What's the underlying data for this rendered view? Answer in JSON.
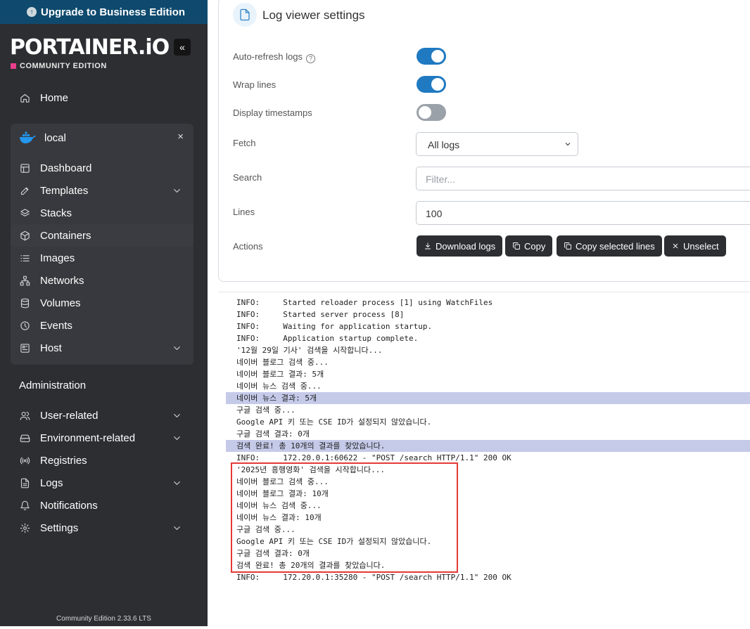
{
  "sidebar": {
    "upgrade_label": "Upgrade to Business Edition",
    "logo": "PORTAINER.iO",
    "edition": "COMMUNITY EDITION",
    "collapse_glyph": "«",
    "home": "Home",
    "environment": {
      "name": "local",
      "close": "×"
    },
    "env_items": [
      {
        "label": "Dashboard"
      },
      {
        "label": "Templates"
      },
      {
        "label": "Stacks"
      },
      {
        "label": "Containers"
      },
      {
        "label": "Images"
      },
      {
        "label": "Networks"
      },
      {
        "label": "Volumes"
      },
      {
        "label": "Events"
      },
      {
        "label": "Host"
      }
    ],
    "admin_title": "Administration",
    "admin_items": [
      {
        "label": "User-related"
      },
      {
        "label": "Environment-related"
      },
      {
        "label": "Registries"
      },
      {
        "label": "Logs"
      },
      {
        "label": "Notifications"
      },
      {
        "label": "Settings"
      }
    ],
    "footer": "Community Edition 2.33.6 LTS"
  },
  "settings": {
    "title": "Log viewer settings",
    "auto_refresh": {
      "label": "Auto-refresh logs",
      "on": true
    },
    "wrap_lines": {
      "label": "Wrap lines",
      "on": true
    },
    "timestamps": {
      "label": "Display timestamps",
      "on": false
    },
    "fetch": {
      "label": "Fetch",
      "value": "All logs"
    },
    "search": {
      "label": "Search",
      "placeholder": "Filter..."
    },
    "lines": {
      "label": "Lines",
      "value": "100"
    },
    "actions": {
      "label": "Actions",
      "download": "Download logs",
      "copy": "Copy",
      "copy_selected": "Copy selected lines",
      "unselect": "Unselect"
    }
  },
  "log_lines": [
    {
      "text": "INFO:     Started reloader process [1] using WatchFiles",
      "selected": false
    },
    {
      "text": "INFO:     Started server process [8]",
      "selected": false
    },
    {
      "text": "INFO:     Waiting for application startup.",
      "selected": false
    },
    {
      "text": "INFO:     Application startup complete.",
      "selected": false
    },
    {
      "text": "'12월 29일 기사' 검색을 시작합니다...",
      "selected": false
    },
    {
      "text": "네이버 블로그 검색 중...",
      "selected": false
    },
    {
      "text": "네이버 블로그 결과: 5개",
      "selected": false
    },
    {
      "text": "네이버 뉴스 검색 중...",
      "selected": false
    },
    {
      "text": "네이버 뉴스 결과: 5개",
      "selected": true
    },
    {
      "text": "구글 검색 중...",
      "selected": false
    },
    {
      "text": "Google API 키 또는 CSE ID가 설정되지 않았습니다.",
      "selected": false
    },
    {
      "text": "구글 검색 결과: 0개",
      "selected": false
    },
    {
      "text": "검색 완료! 총 10개의 결과를 찾았습니다.",
      "selected": true
    },
    {
      "text": "INFO:     172.20.0.1:60622 - \"POST /search HTTP/1.1\" 200 OK",
      "selected": false
    },
    {
      "text": "'2025년 흥행영화' 검색을 시작합니다...",
      "selected": false
    },
    {
      "text": "네이버 블로그 검색 중...",
      "selected": false
    },
    {
      "text": "네이버 블로그 결과: 10개",
      "selected": false
    },
    {
      "text": "네이버 뉴스 검색 중...",
      "selected": false
    },
    {
      "text": "네이버 뉴스 결과: 10개",
      "selected": false
    },
    {
      "text": "구글 검색 중...",
      "selected": false
    },
    {
      "text": "Google API 키 또는 CSE ID가 설정되지 않았습니다.",
      "selected": false
    },
    {
      "text": "구글 검색 결과: 0개",
      "selected": false
    },
    {
      "text": "검색 완료! 총 20개의 결과를 찾았습니다.",
      "selected": false
    },
    {
      "text": "INFO:     172.20.0.1:35280 - \"POST /search HTTP/1.1\" 200 OK",
      "selected": false
    }
  ]
}
